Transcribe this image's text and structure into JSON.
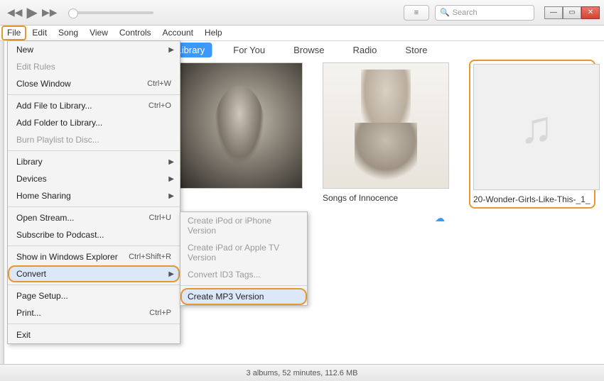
{
  "toolbar": {
    "search_placeholder": "Search"
  },
  "menubar": {
    "items": [
      "File",
      "Edit",
      "Song",
      "View",
      "Controls",
      "Account",
      "Help"
    ]
  },
  "nav": {
    "tabs": [
      "Library",
      "For You",
      "Browse",
      "Radio",
      "Store"
    ]
  },
  "albums": [
    {
      "title": ""
    },
    {
      "title": "Songs of Innocence"
    },
    {
      "title": "20-Wonder-Girls-Like-This-_1_"
    }
  ],
  "file_menu": {
    "new": {
      "label": "New"
    },
    "edit_rules": {
      "label": "Edit Rules"
    },
    "close_window": {
      "label": "Close Window",
      "shortcut": "Ctrl+W"
    },
    "add_file": {
      "label": "Add File to Library...",
      "shortcut": "Ctrl+O"
    },
    "add_folder": {
      "label": "Add Folder to Library..."
    },
    "burn": {
      "label": "Burn Playlist to Disc..."
    },
    "library": {
      "label": "Library"
    },
    "devices": {
      "label": "Devices"
    },
    "home_sharing": {
      "label": "Home Sharing"
    },
    "open_stream": {
      "label": "Open Stream...",
      "shortcut": "Ctrl+U"
    },
    "subscribe": {
      "label": "Subscribe to Podcast..."
    },
    "show_explorer": {
      "label": "Show in Windows Explorer",
      "shortcut": "Ctrl+Shift+R"
    },
    "convert": {
      "label": "Convert"
    },
    "page_setup": {
      "label": "Page Setup..."
    },
    "print": {
      "label": "Print...",
      "shortcut": "Ctrl+P"
    },
    "exit": {
      "label": "Exit"
    }
  },
  "convert_submenu": {
    "ipod": {
      "label": "Create iPod or iPhone Version"
    },
    "ipad": {
      "label": "Create iPad or Apple TV Version"
    },
    "id3": {
      "label": "Convert ID3 Tags..."
    },
    "mp3": {
      "label": "Create MP3 Version"
    }
  },
  "statusbar": {
    "text": "3 albums, 52 minutes, 112.6 MB"
  }
}
